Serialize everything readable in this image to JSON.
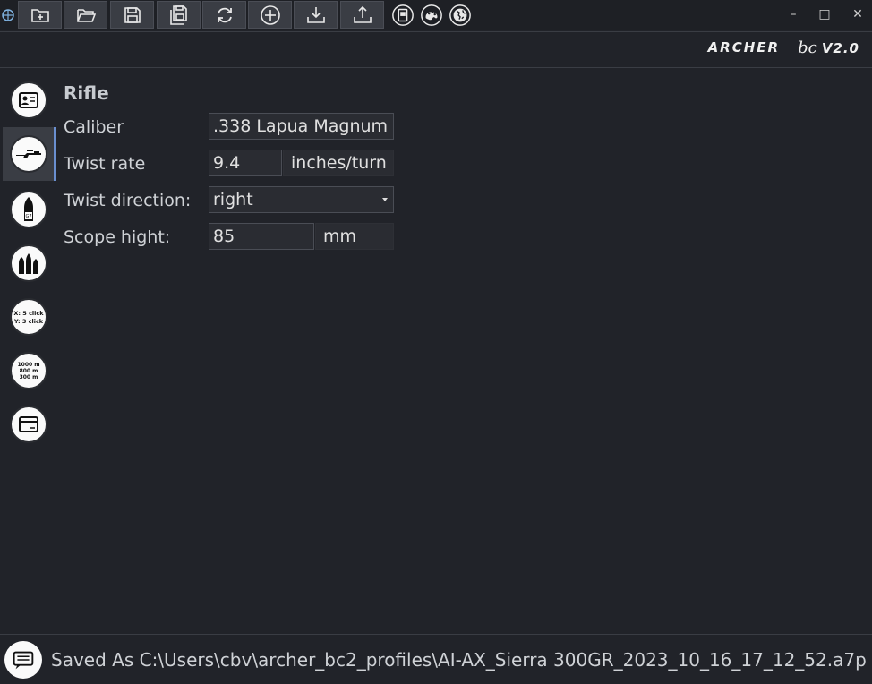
{
  "titlebar": {
    "toolbar": [
      {
        "icon": "new-file-icon"
      },
      {
        "icon": "open-folder-icon"
      },
      {
        "icon": "save-icon"
      },
      {
        "icon": "save-as-icon"
      },
      {
        "icon": "reload-icon"
      },
      {
        "icon": "add-icon"
      },
      {
        "icon": "import-icon"
      },
      {
        "icon": "export-icon"
      }
    ],
    "round_buttons": [
      {
        "icon": "device-icon"
      },
      {
        "icon": "theme-palette-icon"
      },
      {
        "icon": "language-globe-icon"
      }
    ],
    "window_controls": {
      "minimize": "–",
      "maximize": "□",
      "close": "✕"
    }
  },
  "brand": {
    "name": "ARCHER",
    "product": "bc",
    "version": "V2.0"
  },
  "sidebar": {
    "items": [
      {
        "icon": "profile-card-icon",
        "active": false
      },
      {
        "icon": "rifle-icon",
        "active": true
      },
      {
        "icon": "cartridge-icon",
        "active": false
      },
      {
        "icon": "bullets-icon",
        "active": false
      },
      {
        "icon": "zeroing-clicks-icon",
        "text_lines": [
          "X: 5 click",
          "Y: 3 click"
        ],
        "active": false
      },
      {
        "icon": "distances-icon",
        "text_lines": [
          "1000 m",
          "800 m",
          "300 m"
        ],
        "active": false
      },
      {
        "icon": "window-icon",
        "active": false
      }
    ]
  },
  "rifle": {
    "title": "Rifle",
    "caliber_label": "Caliber",
    "caliber_value": ".338 Lapua Magnum",
    "twist_rate_label": "Twist rate",
    "twist_rate_value": "9.4",
    "twist_rate_unit": "inches/turn",
    "twist_direction_label": "Twist direction:",
    "twist_direction_value": "right",
    "scope_height_label": "Scope hight:",
    "scope_height_value": "85",
    "scope_height_unit": "mm"
  },
  "status": {
    "icon": "message-icon",
    "text": "Saved As C:\\Users\\cbv\\archer_bc2_profiles\\AI-AX_Sierra 300GR_2023_10_16_17_12_52.a7p"
  }
}
